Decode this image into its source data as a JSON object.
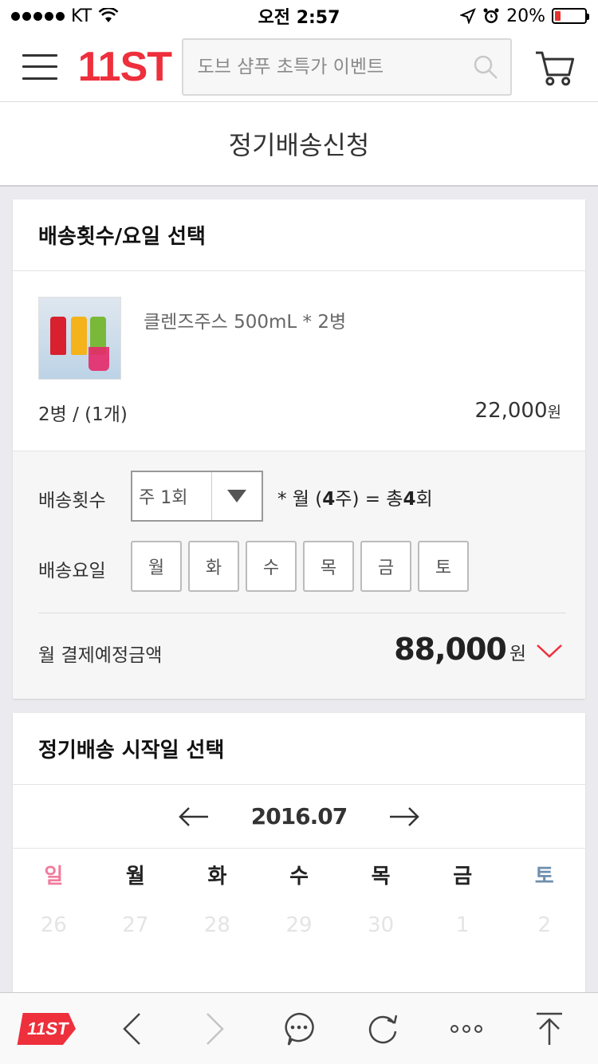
{
  "status_bar": {
    "carrier": "KT",
    "time": "오전 2:57",
    "battery": "20%",
    "battery_level": 0.2
  },
  "header": {
    "logo": "11ST",
    "search": {
      "placeholder": "도브 샴푸 초특가 이벤트"
    }
  },
  "page": {
    "title": "정기배송신청"
  },
  "delivery_section": {
    "title": "배송횟수/요일 선택",
    "product": {
      "name": "클렌즈주스 500mL * 2병",
      "qty_label": "2병 / (1개)",
      "price": "22,000",
      "price_unit": "원"
    },
    "frequency": {
      "label": "배송횟수",
      "selected": "주 1회",
      "note_prefix": "* 월 (",
      "note_weeks": "4",
      "note_mid": "주) = 총",
      "note_total": "4",
      "note_suffix": "회"
    },
    "days": {
      "label": "배송요일",
      "options": [
        "월",
        "화",
        "수",
        "목",
        "금",
        "토"
      ]
    },
    "monthly": {
      "label": "월 결제예정금액",
      "amount": "88,000",
      "unit": "원"
    }
  },
  "start_section": {
    "title": "정기배송 시작일 선택",
    "month": "2016.07",
    "weekdays": [
      "일",
      "월",
      "화",
      "수",
      "목",
      "금",
      "토"
    ],
    "dates": [
      "26",
      "27",
      "28",
      "29",
      "30",
      "1",
      "2"
    ]
  },
  "toolbar": {
    "logo": "11ST"
  },
  "colors": {
    "brand": "#ee2f3c",
    "sunday": "#f07c9c",
    "saturday": "#6e8fae",
    "chevron": "#ee2f3c"
  }
}
